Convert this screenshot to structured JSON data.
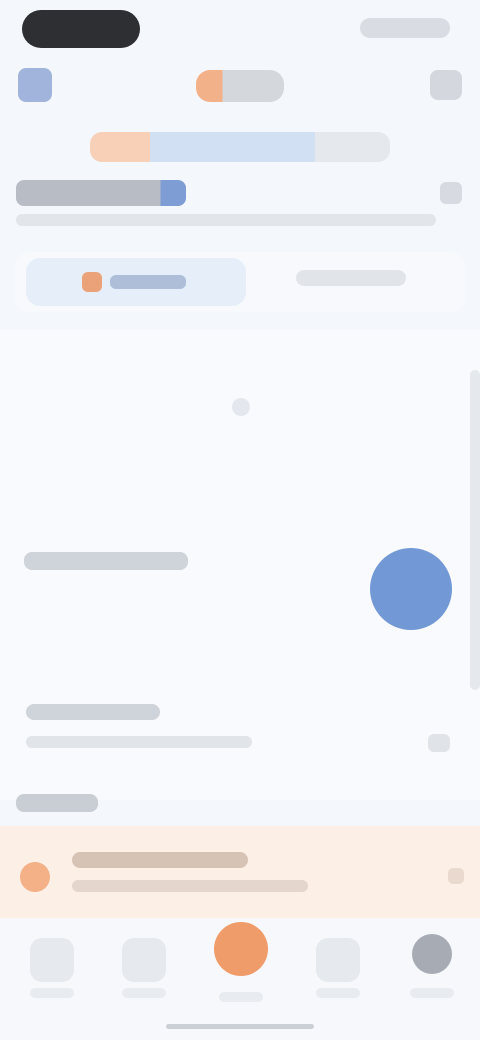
{
  "app": {
    "title": "",
    "promo_text": ""
  },
  "header": {
    "headline": "",
    "subline": ""
  },
  "tabs": [
    {
      "label": "",
      "active": true
    },
    {
      "label": "",
      "active": false
    }
  ],
  "content": {
    "section_1_title": "",
    "section_2_title": "",
    "section_2_subtitle": "",
    "small_label": ""
  },
  "notice": {
    "title": "",
    "subtitle": ""
  },
  "bottom_nav": [
    {
      "label": ""
    },
    {
      "label": ""
    },
    {
      "label": ""
    },
    {
      "label": ""
    },
    {
      "label": ""
    }
  ],
  "colors": {
    "brand_orange": "#f0915a",
    "accent_blue": "#5b87ce",
    "notice_bg": "#fbefe6",
    "background": "#f4f7fb"
  },
  "icons": {
    "back": "back-arrow-icon",
    "more": "more-icon",
    "fab": "action-icon",
    "notice": "alert-icon",
    "profile": "avatar-icon"
  }
}
